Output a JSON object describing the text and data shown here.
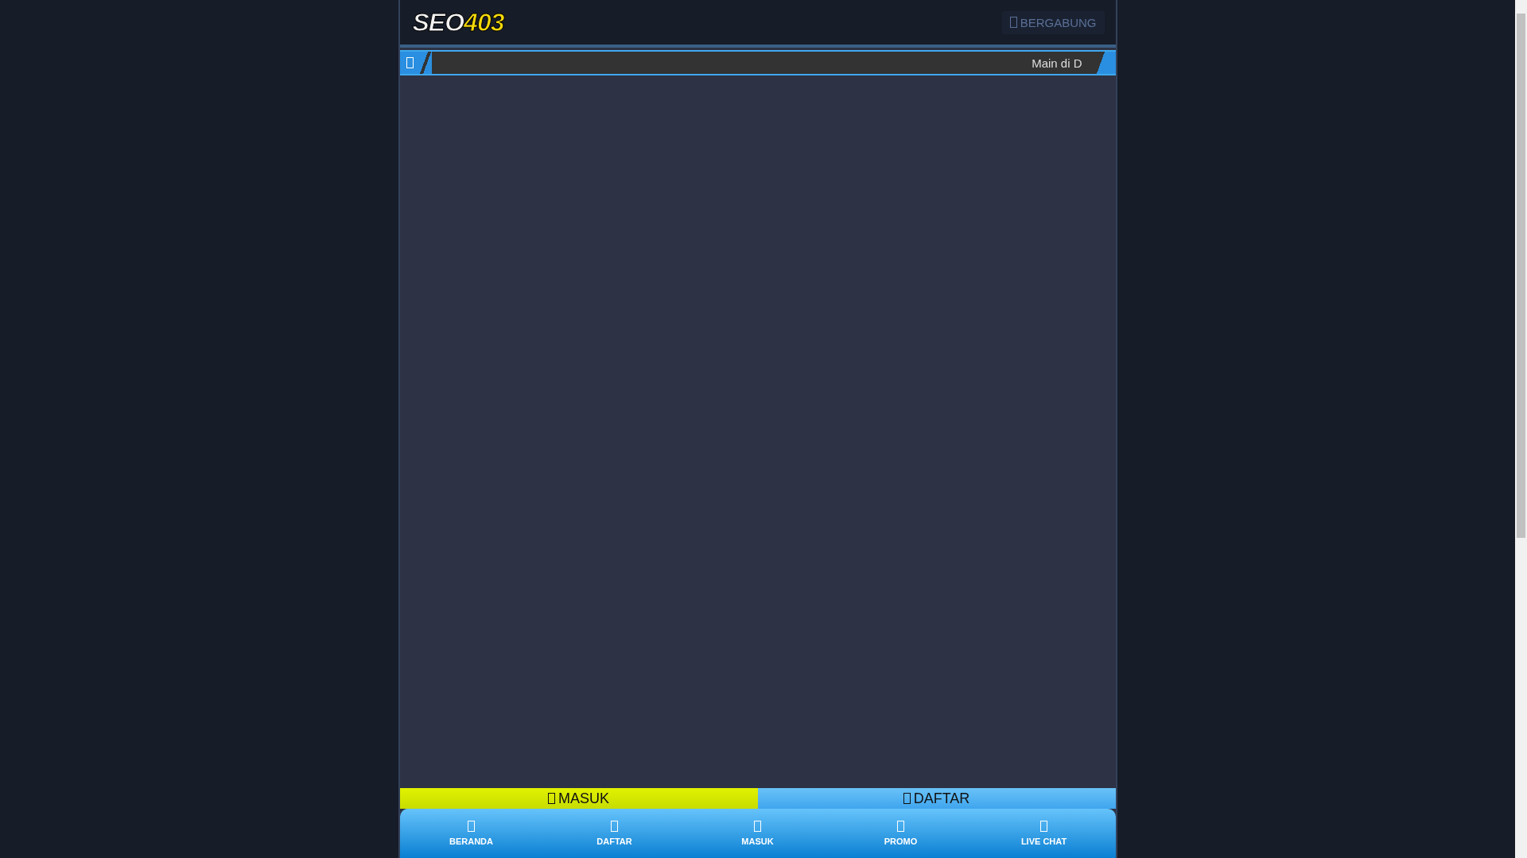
{
  "header": {
    "logo": {
      "text_1": "SEO",
      "text_2": "403"
    },
    "join_button": "BERGABUNG"
  },
  "ticker": {
    "text": "Main di D"
  },
  "action_buttons": [
    {
      "label": "MASUK",
      "kind": "login"
    },
    {
      "label": "DAFTAR",
      "kind": "register"
    }
  ],
  "bottom_nav": [
    {
      "label": "BERANDA"
    },
    {
      "label": "DAFTAR"
    },
    {
      "label": "MASUK"
    },
    {
      "label": "PROMO"
    },
    {
      "label": "LIVE CHAT"
    }
  ]
}
